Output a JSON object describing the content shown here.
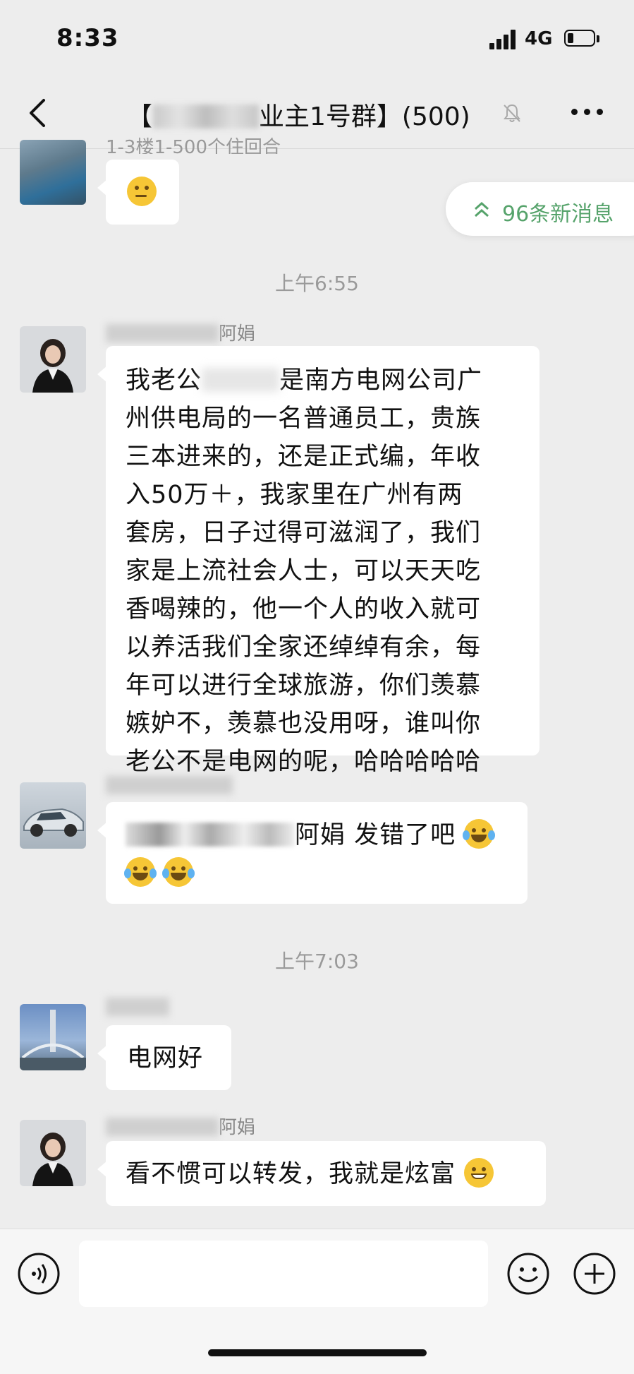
{
  "status_bar": {
    "time": "8:33",
    "network": "4G"
  },
  "nav": {
    "title_prefix": "【",
    "title_suffix": "业主1号群】(500)"
  },
  "new_messages_pill": {
    "text": "96条新消息"
  },
  "messages": {
    "m1": {
      "sender_partial": "1-3楼1-500个住回合"
    },
    "ts1": "上午6:55",
    "m2": {
      "sender_suffix": "阿娟",
      "text_lines": [
        "我老公",
        "是南方电网公司广",
        "州供电局的一名普通员工，贵族",
        "三本进来的，还是正式编，年收",
        "入50万＋，我家里在广州有两",
        "套房，日子过得可滋润了，我们",
        "家是上流社会人士，可以天天吃",
        "香喝辣的，他一个人的收入就可",
        "以养活我们全家还绰绰有余，每",
        "年可以进行全球旅游，你们羡慕",
        "嫉妒不，羡慕也没用呀，谁叫你",
        "老公不是电网的呢，哈哈哈哈哈"
      ]
    },
    "m3": {
      "text": "阿娟 发错了吧"
    },
    "ts2": "上午7:03",
    "m4": {
      "text": "电网好"
    },
    "m5": {
      "sender_suffix": "阿娟",
      "text": "看不惯可以转发，我就是炫富"
    }
  },
  "input": {
    "placeholder": ""
  },
  "colors": {
    "background": "#ededed",
    "bubble": "#ffffff",
    "accent_green": "#56a36b",
    "timestamp": "#9a9a9a"
  }
}
